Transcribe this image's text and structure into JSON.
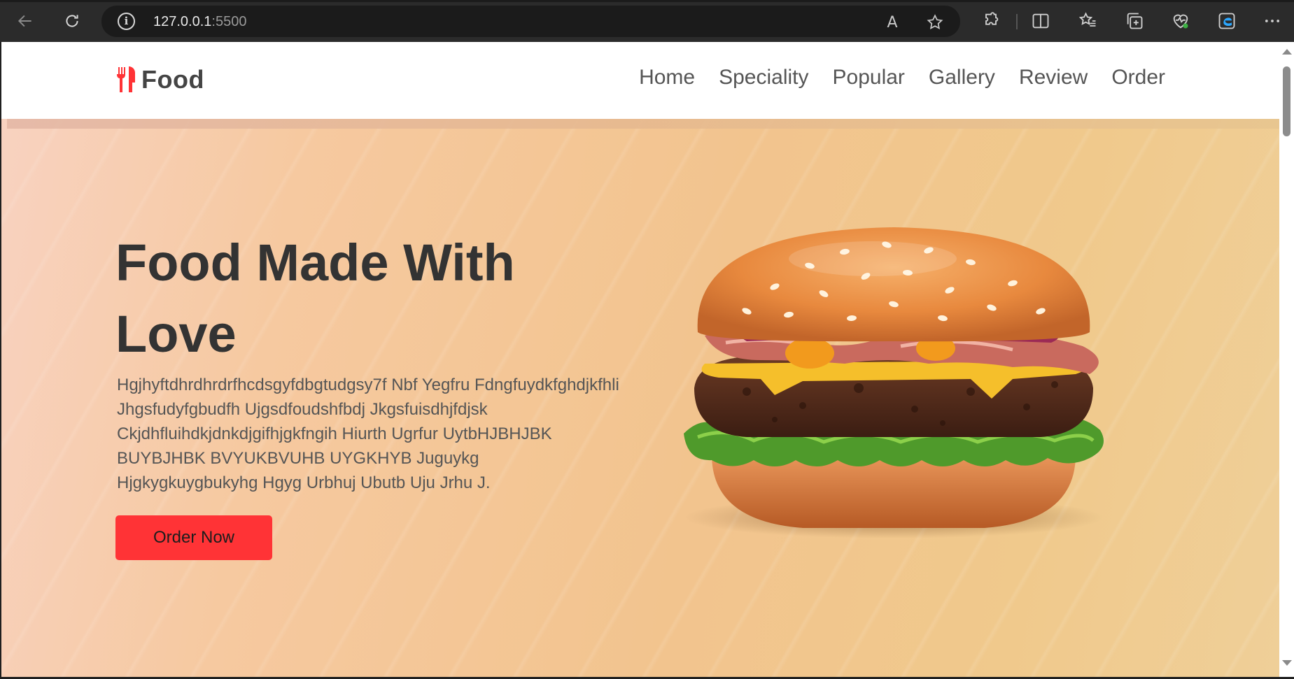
{
  "browser": {
    "url_host": "127.0.0.1",
    "url_port": ":5500",
    "icons": [
      "back-arrow-icon",
      "refresh-icon",
      "info-icon",
      "read-aloud-icon",
      "favorite-star-icon",
      "extensions-icon",
      "split-screen-icon",
      "favorites-list-icon",
      "collections-icon",
      "browser-essentials-icon",
      "edge-bar-icon",
      "more-options-icon"
    ],
    "read_aloud_glyph": "A"
  },
  "site": {
    "logo_text": "Food",
    "logo_icon": "fork-knife-icon",
    "brand_color": "#ff3336",
    "nav": [
      {
        "label": "Home"
      },
      {
        "label": "Speciality"
      },
      {
        "label": "Popular"
      },
      {
        "label": "Gallery"
      },
      {
        "label": "Review"
      },
      {
        "label": "Order"
      }
    ]
  },
  "hero": {
    "title_line1": "Food Made With",
    "title_line2": "Love",
    "description": "Hgjhyftdhrdhrdrfhcdsgyfdbgtudgsy7f Nbf Yegfru Fdngfuydkfghdjkfhli Jhgsfudyfgbudfh Ujgsdfoudshfbdj Jkgsfuisdhjfdjsk Ckjdhfluihdkjdnkdjgifhjgkfngih Hiurth Ugrfur UytbHJBHJBK BUYBJHBK BVYUKBVUHB UYGKHYB Juguykg Hjgkygkuygbukyhg Hgyg Urbhuj Ubutb Uju Jrhu J.",
    "cta_label": "Order Now",
    "image": "burger-image"
  }
}
